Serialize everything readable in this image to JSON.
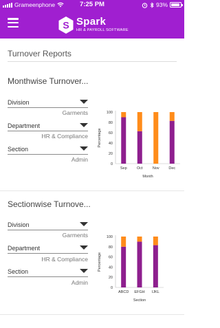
{
  "status_bar": {
    "carrier": "Grameenphone",
    "time": "7:25 PM",
    "battery": "93%"
  },
  "header": {
    "brand_name": "Spark",
    "brand_tagline": "HR & PAYROLL SOFTWARE"
  },
  "page_title": "Turnover Reports",
  "cards": [
    {
      "title": "Monthwise Turnover...",
      "filters": [
        {
          "label": "Division",
          "value": "Garments"
        },
        {
          "label": "Department",
          "value": "HR & Compliance"
        },
        {
          "label": "Section",
          "value": "Admin"
        }
      ]
    },
    {
      "title": "Sectionwise Turnove...",
      "filters": [
        {
          "label": "Division",
          "value": "Garments"
        },
        {
          "label": "Department",
          "value": "HR & Compliance"
        },
        {
          "label": "Section",
          "value": "Admin"
        }
      ]
    }
  ],
  "colors": {
    "header": "#a01fd0",
    "bar_bottom": "#8e1f8e",
    "bar_top": "#ff8c1a"
  },
  "chart_data": [
    {
      "type": "bar",
      "stacked": true,
      "categories": [
        "Sep",
        "Oct",
        "Nov",
        "Dec"
      ],
      "series": [
        {
          "values": [
            90,
            63,
            0,
            83
          ]
        },
        {
          "values": [
            10,
            37,
            100,
            17
          ]
        }
      ],
      "xlabel": "Month",
      "ylabel": "Percentage",
      "ylim": [
        0,
        100
      ],
      "yticks": [
        0,
        20,
        40,
        60,
        80,
        100
      ]
    },
    {
      "type": "bar",
      "stacked": true,
      "categories": [
        "ABCD",
        "EFGH",
        "IJKL"
      ],
      "series": [
        {
          "values": [
            80,
            90,
            83
          ]
        },
        {
          "values": [
            20,
            10,
            17
          ]
        }
      ],
      "xlabel": "Section",
      "ylabel": "Percentage",
      "ylim": [
        0,
        100
      ],
      "yticks": [
        0,
        20,
        40,
        60,
        80,
        100
      ]
    }
  ]
}
